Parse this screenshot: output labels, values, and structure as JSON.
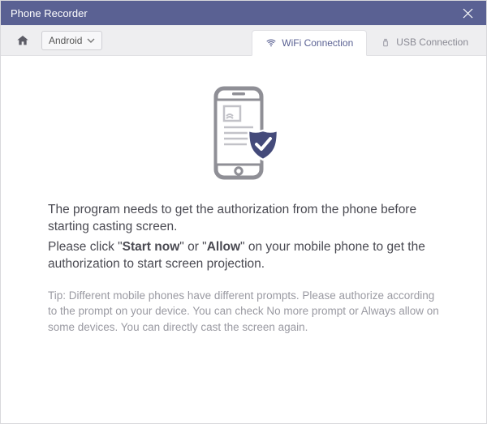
{
  "titlebar": {
    "title": "Phone Recorder"
  },
  "toolbar": {
    "os_label": "Android",
    "tabs": {
      "wifi": "WiFi Connection",
      "usb": "USB Connection"
    }
  },
  "content": {
    "line1": "The program needs to get the authorization from the phone before starting casting screen.",
    "line2_pre": "Please click \"",
    "line2_bold1": "Start now",
    "line2_mid": "\" or \"",
    "line2_bold2": "Allow",
    "line2_post": "\" on your mobile phone to get the authorization to start screen projection.",
    "tip": "Tip: Different mobile phones have different prompts. Please authorize according to the prompt on your device. You can check No more prompt or Always allow on some devices. You can directly cast the screen again."
  }
}
